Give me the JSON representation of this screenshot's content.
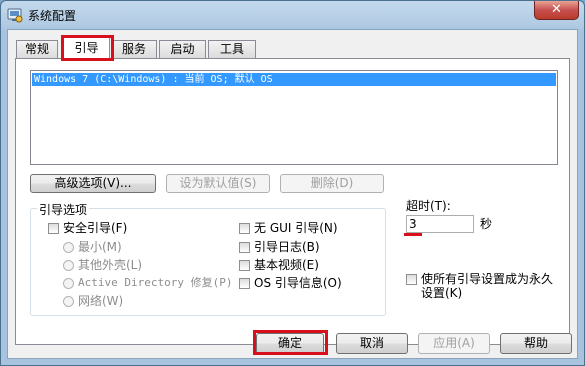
{
  "window": {
    "title": "系统配置",
    "close_glyph": "✕"
  },
  "tabs": [
    {
      "label": "常规",
      "active": false
    },
    {
      "label": "引导",
      "active": true
    },
    {
      "label": "服务",
      "active": false
    },
    {
      "label": "启动",
      "active": false
    },
    {
      "label": "工具",
      "active": false
    }
  ],
  "boot_list": {
    "entries": [
      "Windows 7 (C:\\Windows) : 当前 OS; 默认 OS"
    ],
    "selected_index": 0
  },
  "list_buttons": {
    "advanced": "高级选项(V)...",
    "set_default": "设为默认值(S)",
    "delete": "删除(D)"
  },
  "boot_options": {
    "group_label": "引导选项",
    "safe_boot": {
      "label": "安全引导(F)",
      "checked": false
    },
    "safe_modes": [
      "最小(M)",
      "其他外壳(L)",
      "Active Directory 修复(P)",
      "网络(W)"
    ],
    "no_gui": {
      "label": "无 GUI 引导(N)",
      "checked": false
    },
    "boot_log": {
      "label": "引导日志(B)",
      "checked": false
    },
    "base_video": {
      "label": "基本视频(E)",
      "checked": false
    },
    "os_boot_info": {
      "label": "OS 引导信息(O)",
      "checked": false
    }
  },
  "timeout": {
    "label": "超时(T):",
    "value": "3",
    "unit": "秒"
  },
  "permanent": {
    "label_line1": "使所有引导设置成为永久",
    "label_line2": "设置(K)",
    "checked": false
  },
  "footer": {
    "ok": "确定",
    "cancel": "取消",
    "apply": "应用(A)",
    "help": "帮助"
  },
  "colors": {
    "selection": "#3399ff",
    "highlight_box": "#d8101c",
    "title_bar": "#b1cbe3",
    "close_button": "#c75050"
  },
  "icons": {
    "app": "system-config-icon",
    "close": "close-icon"
  }
}
